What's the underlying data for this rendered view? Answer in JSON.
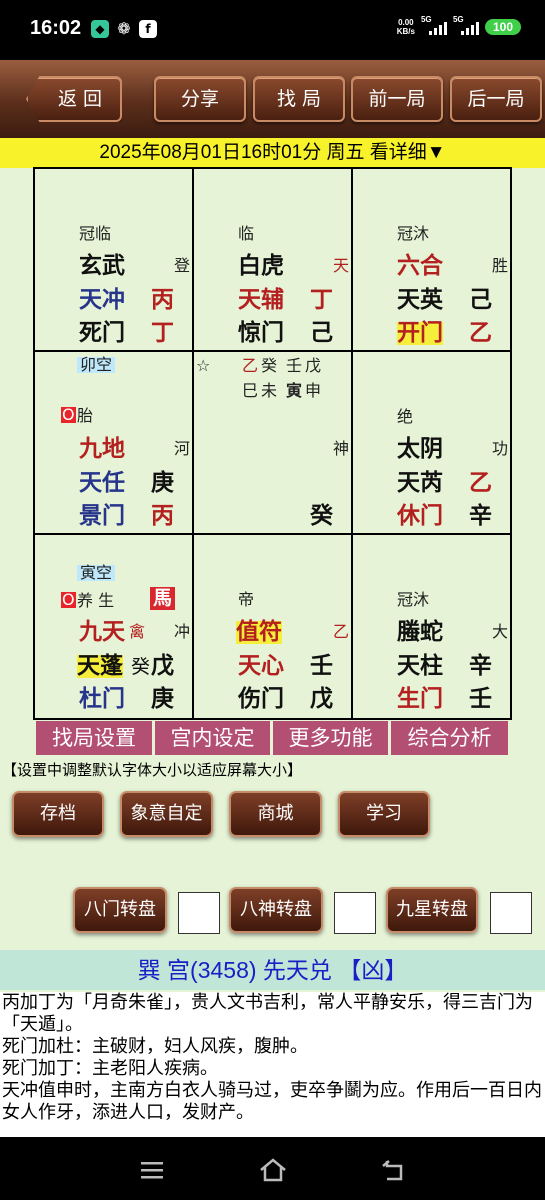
{
  "status": {
    "time": "16:02",
    "net_speed": "0.00",
    "net_unit": "KB/s",
    "sig1": "5G",
    "sig2": "5G",
    "battery": "100",
    "icons": [
      "shield-app-icon",
      "wechat-icon",
      "facebook-icon"
    ]
  },
  "toolbar": {
    "back": "返 回",
    "share": "分享",
    "find": "找 局",
    "prev": "前一局",
    "next": "后一局"
  },
  "datebar": "2025年08月01日16时01分 周五 看详细▼",
  "grid": [
    {
      "state": "冠临",
      "god": "玄武",
      "god_side": "登",
      "star": "天冲",
      "star_stem": "丙",
      "door": "死门",
      "door_stem": "丁"
    },
    {
      "state": "临",
      "god": "白虎",
      "god_side": "天",
      "star": "天辅",
      "star_stem": "丁",
      "door": "惊门",
      "door_stem": "己"
    },
    {
      "state": "冠沐",
      "god": "六合",
      "god_side": "胜",
      "star": "天英",
      "star_stem": "己",
      "door": "开门",
      "door_stem": "乙"
    },
    {
      "empty": "卯空",
      "marker": "O",
      "state": "胎",
      "god": "九地",
      "god_side": "河",
      "star": "天任",
      "star_stem": "庚",
      "door": "景门",
      "door_stem": "丙"
    },
    {
      "star_sym": "☆",
      "row1": [
        "乙",
        "癸",
        "壬",
        "戊"
      ],
      "row2": [
        "巳",
        "未",
        "寅",
        "申"
      ],
      "side": "神",
      "bottom": "癸"
    },
    {
      "state": "绝",
      "god": "太阴",
      "god_side": "功",
      "star": "天芮",
      "star_stem": "乙",
      "door": "休门",
      "door_stem": "辛"
    },
    {
      "empty": "寅空",
      "marker": "O",
      "state": "养 生",
      "horse": "馬",
      "god": "九天",
      "god_extra": "禽",
      "god_side": "冲",
      "star": "天蓬",
      "star_extra": "癸",
      "star_stem": "戊",
      "door": "杜门",
      "door_stem": "庚"
    },
    {
      "state": "帝",
      "god": "值符",
      "god_side": "乙",
      "star": "天心",
      "star_stem": "壬",
      "door": "伤门",
      "door_stem": "戊"
    },
    {
      "state": "冠沐",
      "god": "螣蛇",
      "god_side": "大",
      "star": "天柱",
      "star_stem": "辛",
      "door": "生门",
      "door_stem": "壬"
    }
  ],
  "menu": [
    "找局设置",
    "宫内设定",
    "更多功能",
    "综合分析"
  ],
  "note": "【设置中调整默认字体大小以适应屏幕大小】",
  "actions": [
    "存档",
    "象意自定",
    "商城",
    "学习"
  ],
  "toggles": [
    "八门转盘",
    "八神转盘",
    "九星转盘"
  ],
  "info": {
    "title": "巽 宫(3458) 先天兑 【凶】",
    "lines": [
      "丙加丁为「月奇朱雀」，贵人文书吉利，常人平静安乐，得三吉门为「天遁」。",
      "死门加杜：主破财，妇人风疾，腹肿。",
      "死门加丁：主老阳人疾病。",
      "天冲值申时，主南方白衣人骑马过，吏卒争鬬为应。作用后一百日内女人作牙，添进人口，发财产。"
    ]
  }
}
